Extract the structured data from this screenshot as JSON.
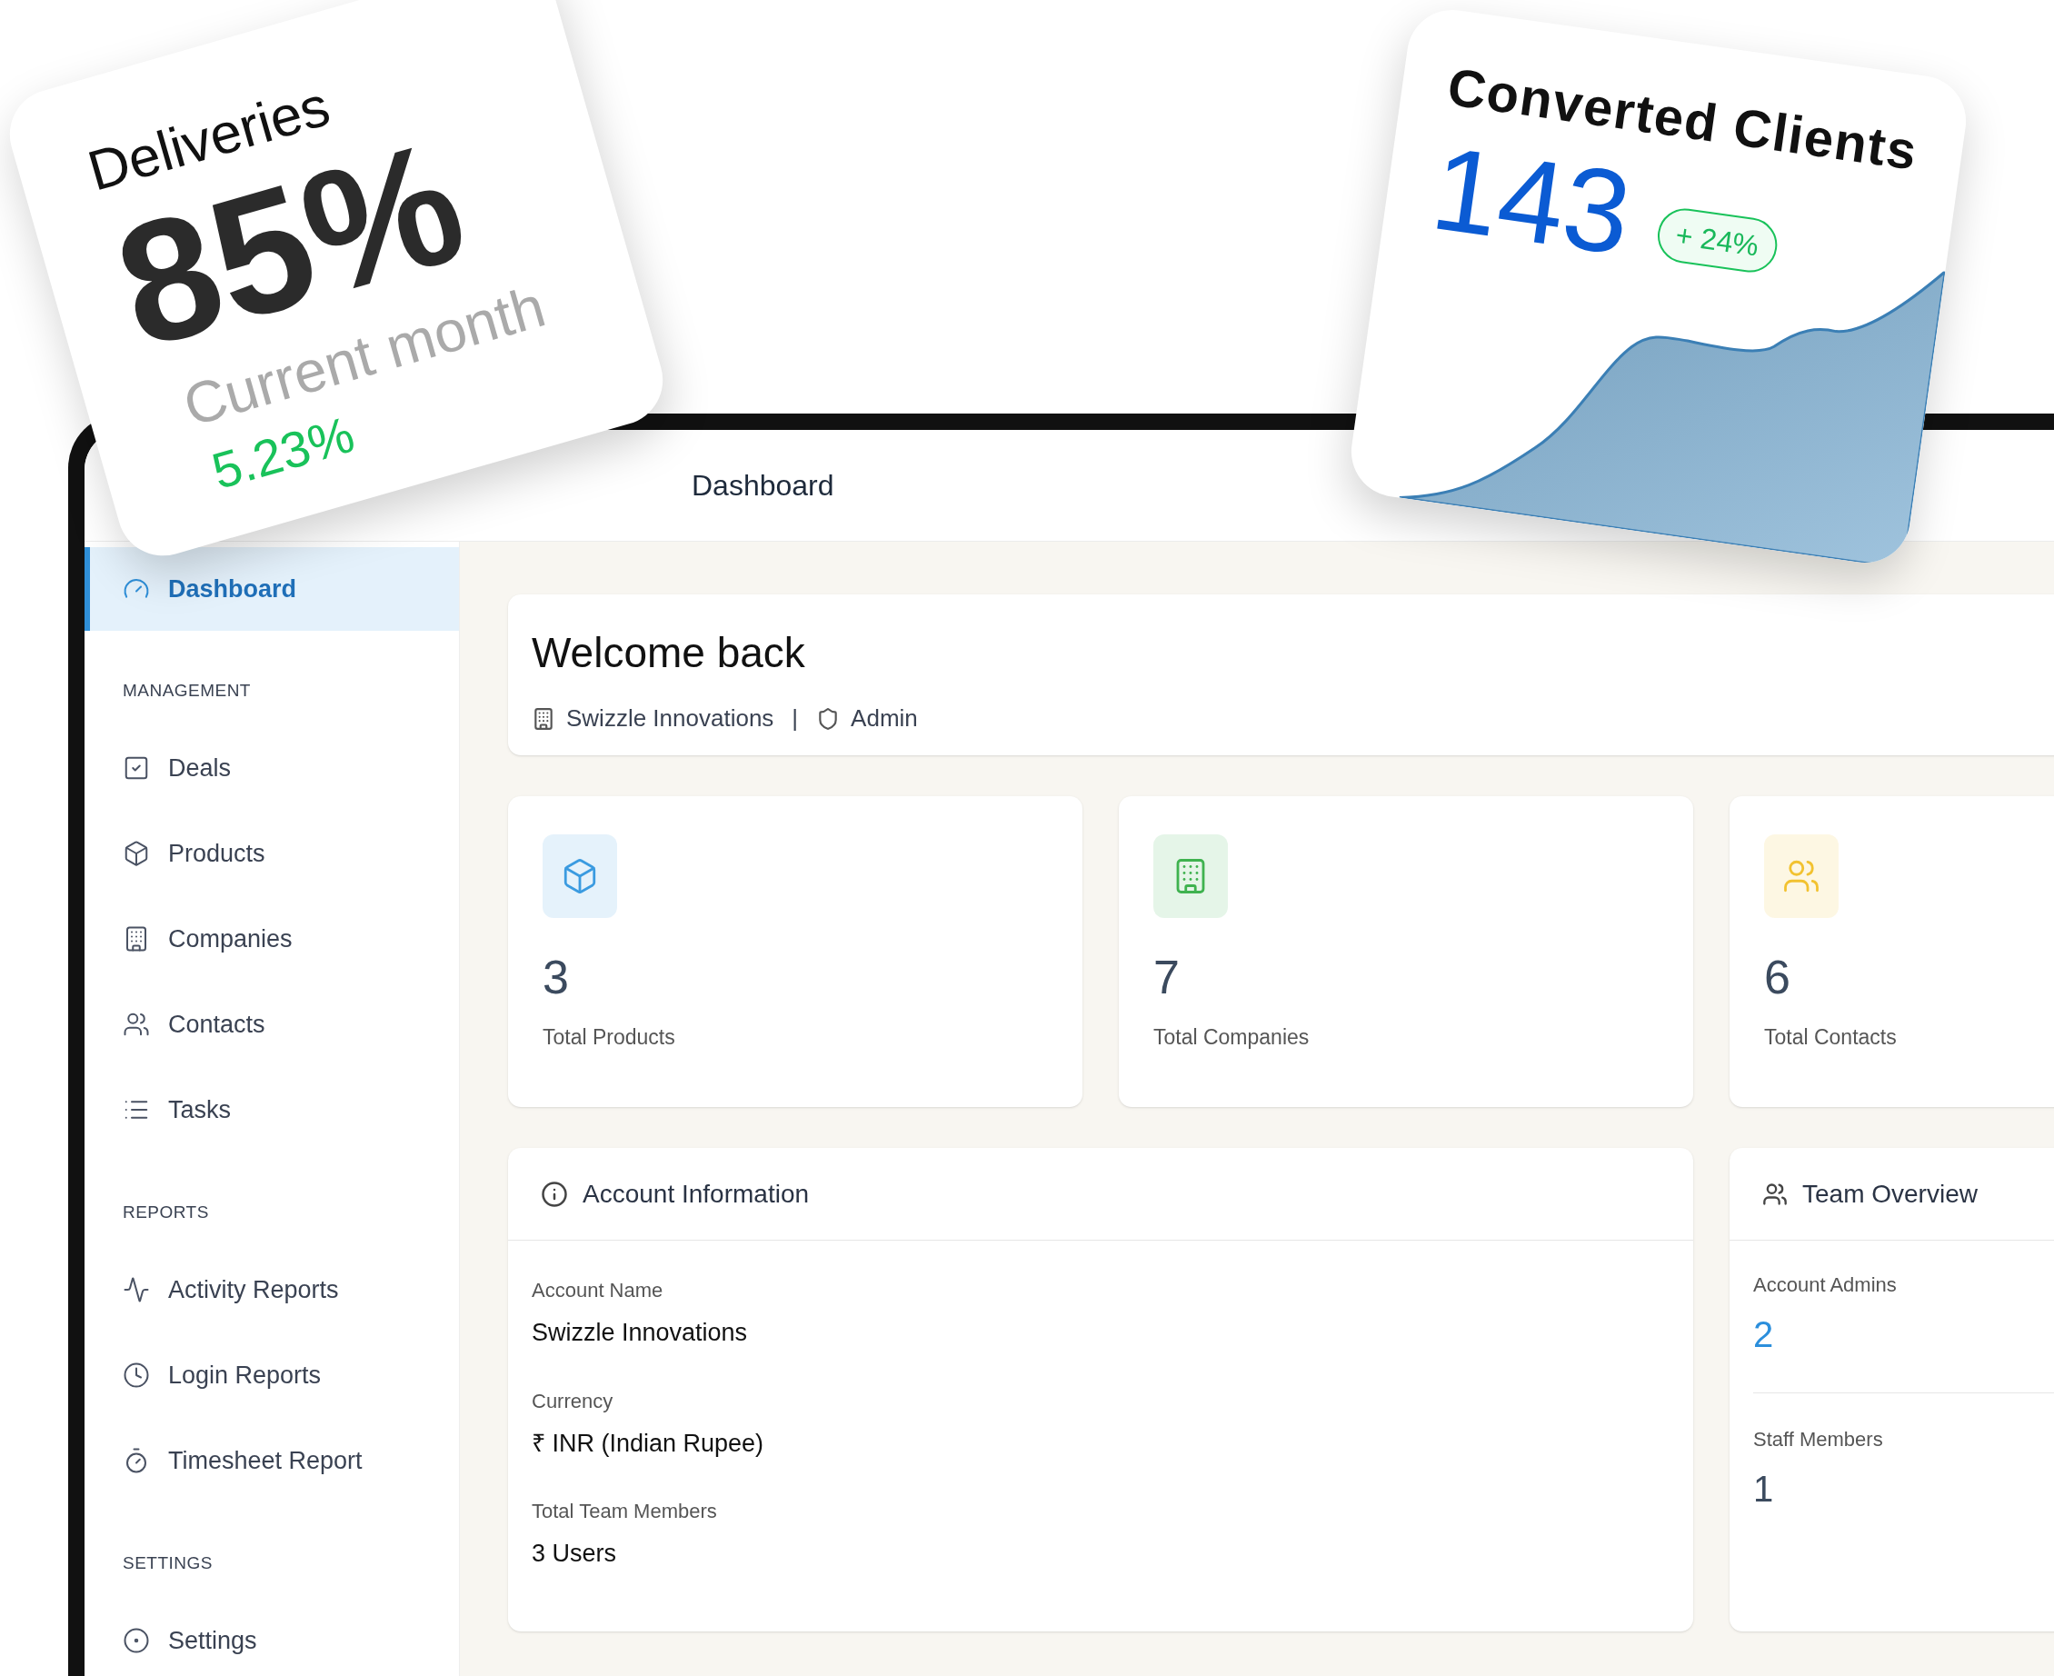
{
  "deliveries_card": {
    "title": "Deliveries",
    "value": "85%",
    "caption": "Current month",
    "change": "5.23%"
  },
  "clients_card": {
    "title": "Converted Clients",
    "value": "143",
    "badge": "+ 24%"
  },
  "header": {
    "title": "Dashboard"
  },
  "sidebar": {
    "items": [
      {
        "label": "Dashboard",
        "kind": "gauge",
        "selected": true
      }
    ],
    "sections": [
      {
        "title": "MANAGEMENT",
        "items": [
          {
            "label": "Deals",
            "kind": "check",
            "selected": false
          },
          {
            "label": "Products",
            "kind": "box",
            "selected": false
          },
          {
            "label": "Companies",
            "kind": "building",
            "selected": false
          },
          {
            "label": "Contacts",
            "kind": "users",
            "selected": false
          },
          {
            "label": "Tasks",
            "kind": "list",
            "selected": false
          }
        ]
      },
      {
        "title": "REPORTS",
        "items": [
          {
            "label": "Activity Reports",
            "kind": "activity",
            "selected": false
          },
          {
            "label": "Login Reports",
            "kind": "clock",
            "selected": false
          },
          {
            "label": "Timesheet Report",
            "kind": "timer",
            "selected": false
          }
        ]
      },
      {
        "title": "SETTINGS",
        "items": [
          {
            "label": "Settings",
            "kind": "settings",
            "selected": false
          }
        ]
      }
    ]
  },
  "welcome": {
    "title": "Welcome back",
    "company": "Swizzle Innovations",
    "separator": "|",
    "role": "Admin"
  },
  "stats": [
    {
      "value": "3",
      "label": "Total Products",
      "kind": "box",
      "color": "#3b9be0"
    },
    {
      "value": "7",
      "label": "Total Companies",
      "kind": "building",
      "color": "#3fb24f"
    },
    {
      "value": "6",
      "label": "Total Contacts",
      "kind": "users",
      "color": "#f2c230"
    }
  ],
  "account_info": {
    "title": "Account Information",
    "fields": [
      {
        "label": "Account Name",
        "value": "Swizzle Innovations"
      },
      {
        "label": "Currency",
        "value": "₹ INR (Indian Rupee)"
      },
      {
        "label": "Total Team Members",
        "value": "3 Users"
      }
    ]
  },
  "team_overview": {
    "title": "Team Overview",
    "fields": [
      {
        "label": "Account Admins",
        "value": "2",
        "highlighted": true
      },
      {
        "label": "Staff Members",
        "value": "1",
        "highlighted": false
      }
    ]
  }
}
